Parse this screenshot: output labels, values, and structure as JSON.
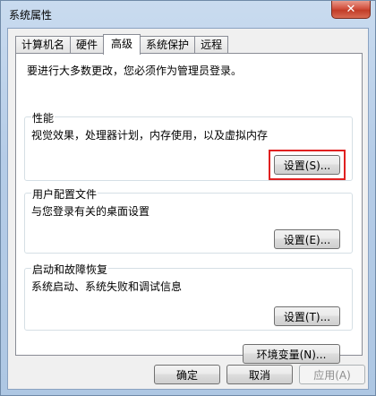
{
  "window": {
    "title": "系统属性",
    "close_glyph": "✕"
  },
  "tabs": [
    {
      "label": "计算机名",
      "active": false
    },
    {
      "label": "硬件",
      "active": false
    },
    {
      "label": "高级",
      "active": true
    },
    {
      "label": "系统保护",
      "active": false
    },
    {
      "label": "远程",
      "active": false
    }
  ],
  "panel": {
    "admin_note": "要进行大多数更改，您必须作为管理员登录。",
    "performance": {
      "label": "性能",
      "description": "视觉效果，处理器计划，内存使用，以及虚拟内存",
      "button": "设置(S)..."
    },
    "user_profiles": {
      "label": "用户配置文件",
      "description": "与您登录有关的桌面设置",
      "button": "设置(E)..."
    },
    "startup_recovery": {
      "label": "启动和故障恢复",
      "description": "系统启动、系统失败和调试信息",
      "button": "设置(T)..."
    },
    "env_button": "环境变量(N)..."
  },
  "footer": {
    "ok": "确定",
    "cancel": "取消",
    "apply": "应用(A)"
  }
}
